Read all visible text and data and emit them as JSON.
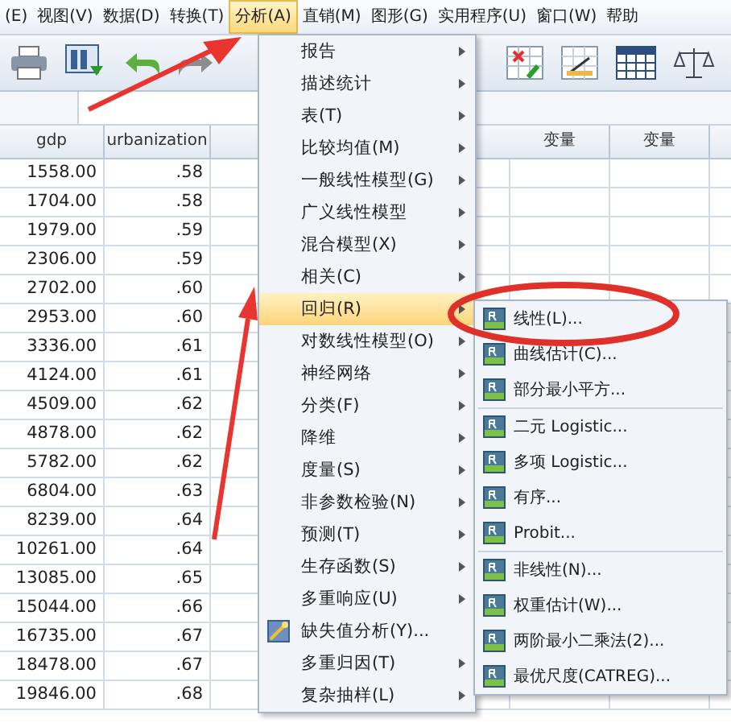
{
  "menu_bar": [
    {
      "label": "(E)",
      "selected": false
    },
    {
      "label": "视图(V)",
      "selected": false
    },
    {
      "label": "数据(D)",
      "selected": false
    },
    {
      "label": "转换(T)",
      "selected": false
    },
    {
      "label": "分析(A)",
      "selected": true
    },
    {
      "label": "直销(M)",
      "selected": false
    },
    {
      "label": "图形(G)",
      "selected": false
    },
    {
      "label": "实用程序(U)",
      "selected": false
    },
    {
      "label": "窗口(W)",
      "selected": false
    },
    {
      "label": "帮助",
      "selected": false
    }
  ],
  "table": {
    "columns": [
      "gdp",
      "urbanization",
      "变量",
      "变量"
    ],
    "rows": [
      [
        "1558.00",
        ".58"
      ],
      [
        "1704.00",
        ".58"
      ],
      [
        "1979.00",
        ".59"
      ],
      [
        "2306.00",
        ".59"
      ],
      [
        "2702.00",
        ".60"
      ],
      [
        "2953.00",
        ".60"
      ],
      [
        "3336.00",
        ".61"
      ],
      [
        "4124.00",
        ".61"
      ],
      [
        "4509.00",
        ".62"
      ],
      [
        "4878.00",
        ".62"
      ],
      [
        "5782.00",
        ".62"
      ],
      [
        "6804.00",
        ".63"
      ],
      [
        "8239.00",
        ".64"
      ],
      [
        "10261.00",
        ".64"
      ],
      [
        "13085.00",
        ".65"
      ],
      [
        "15044.00",
        ".66"
      ],
      [
        "16735.00",
        ".67"
      ],
      [
        "18478.00",
        ".67"
      ],
      [
        "19846.00",
        ".68"
      ]
    ]
  },
  "analyze_menu": [
    {
      "label": "报告",
      "kind": "submenu",
      "selected": false
    },
    {
      "label": "描述统计",
      "kind": "submenu",
      "selected": false
    },
    {
      "label": "表(T)",
      "kind": "submenu",
      "selected": false
    },
    {
      "label": "比较均值(M)",
      "kind": "submenu",
      "selected": false
    },
    {
      "label": "一般线性模型(G)",
      "kind": "submenu",
      "selected": false
    },
    {
      "label": "广义线性模型",
      "kind": "submenu",
      "selected": false
    },
    {
      "label": "混合模型(X)",
      "kind": "submenu",
      "selected": false
    },
    {
      "label": "相关(C)",
      "kind": "submenu",
      "selected": false
    },
    {
      "label": "回归(R)",
      "kind": "submenu",
      "selected": true
    },
    {
      "label": "对数线性模型(O)",
      "kind": "submenu",
      "selected": false
    },
    {
      "label": "神经网络",
      "kind": "submenu",
      "selected": false
    },
    {
      "label": "分类(F)",
      "kind": "submenu",
      "selected": false
    },
    {
      "label": "降维",
      "kind": "submenu",
      "selected": false
    },
    {
      "label": "度量(S)",
      "kind": "submenu",
      "selected": false
    },
    {
      "label": "非参数检验(N)",
      "kind": "submenu",
      "selected": false
    },
    {
      "label": "预测(T)",
      "kind": "submenu",
      "selected": false
    },
    {
      "label": "生存函数(S)",
      "kind": "submenu",
      "selected": false
    },
    {
      "label": "多重响应(U)",
      "kind": "submenu",
      "selected": false
    },
    {
      "label": "缺失值分析(Y)...",
      "kind": "dialog",
      "selected": false
    },
    {
      "label": "多重归因(T)",
      "kind": "submenu",
      "selected": false
    },
    {
      "label": "复杂抽样(L)",
      "kind": "submenu",
      "selected": false
    }
  ],
  "regression_submenu": [
    [
      {
        "label": "线性(L)..."
      },
      {
        "label": "曲线估计(C)..."
      },
      {
        "label": "部分最小平方..."
      }
    ],
    [
      {
        "label": "二元 Logistic..."
      },
      {
        "label": "多项 Logistic..."
      },
      {
        "label": "有序..."
      },
      {
        "label": "Probit..."
      }
    ],
    [
      {
        "label": "非线性(N)..."
      },
      {
        "label": "权重估计(W)..."
      },
      {
        "label": "两阶最小二乘法(2)..."
      },
      {
        "label": "最优尺度(CATREG)..."
      }
    ]
  ]
}
